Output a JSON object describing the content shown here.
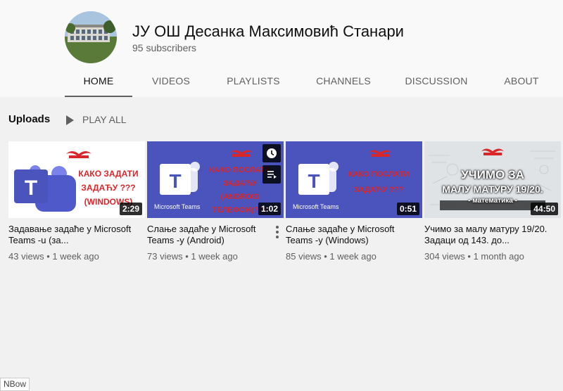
{
  "channel": {
    "name": "ЈУ ОШ Десанка Максимовић Станари",
    "subscribers": "95 subscribers"
  },
  "tabs": [
    {
      "label": "HOME",
      "active": true
    },
    {
      "label": "VIDEOS"
    },
    {
      "label": "PLAYLISTS"
    },
    {
      "label": "CHANNELS"
    },
    {
      "label": "DISCUSSION"
    },
    {
      "label": "ABOUT"
    }
  ],
  "uploads": {
    "title": "Uploads",
    "play_all": "PLAY ALL"
  },
  "videos": [
    {
      "title": "Задавање задаће у Microsoft Teams -u (за...",
      "meta": "43 views • 1 week ago",
      "duration": "2:29",
      "thumb_text": [
        "КАКО ЗАДАТИ",
        "ЗАДАЋУ ???",
        "(WINDOWS)"
      ]
    },
    {
      "title": "Слање задаће у Microsoft Teams -у (Android)",
      "meta": "73 views • 1 week ago",
      "duration": "1:02",
      "thumb_text": [
        "КАКО ПОСЛАТИ",
        "ЗАДАЋУ",
        "(ANDROID",
        "ТЕЛЕФОН)???"
      ],
      "thumb_caption": "Microsoft Teams"
    },
    {
      "title": "Слање задаће у Microsoft Teams -у (Windows)",
      "meta": "85 views • 1 week ago",
      "duration": "0:51",
      "thumb_text": [
        "КАКО ПОСЛАТИ",
        "ЗАДАЋУ ???"
      ],
      "thumb_caption": "Microsoft Teams"
    },
    {
      "title": "Учимо за малу матуру 19/20. Задаци од 143. до...",
      "meta": "304 views • 1 month ago",
      "duration": "44:50",
      "thumb_text": [
        "УЧИМО ЗА",
        "МАЛУ МАТУРУ 19/20.",
        "- математика -"
      ]
    }
  ],
  "corner_badge": "NBow",
  "colors": {
    "teams_purple": "#4b53bc",
    "school_red": "#d8262b",
    "header_bg": "#f9f9f9",
    "page_bg": "#f1f1f1"
  }
}
